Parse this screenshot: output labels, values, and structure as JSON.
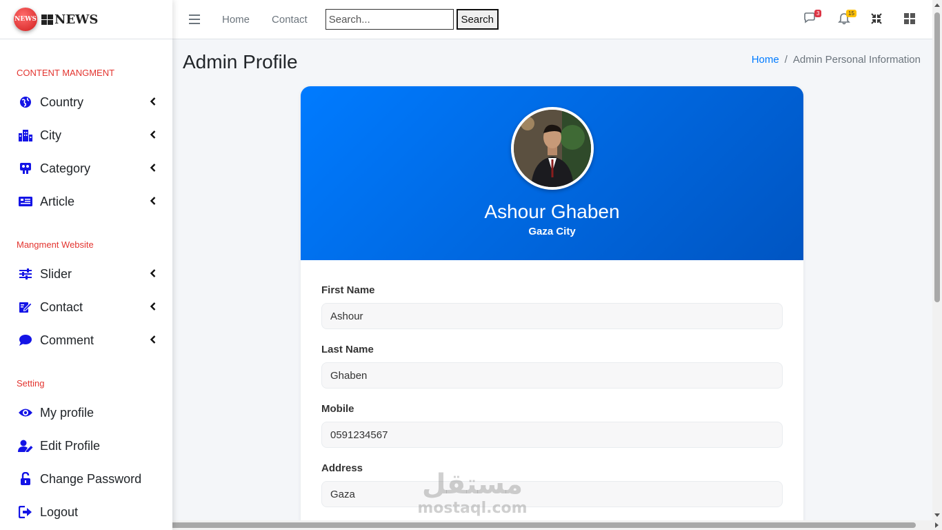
{
  "brand": {
    "logo_text": "NEWS",
    "name": "NEWS"
  },
  "sidebar": {
    "sections": [
      {
        "header": "CONTENT MANGMENT"
      },
      {
        "header": "Mangment Website"
      },
      {
        "header": "Setting"
      }
    ],
    "items": [
      {
        "label": "Country",
        "icon": "globe-icon"
      },
      {
        "label": "City",
        "icon": "city-icon"
      },
      {
        "label": "Category",
        "icon": "category-icon"
      },
      {
        "label": "Article",
        "icon": "article-icon"
      },
      {
        "label": "Slider",
        "icon": "sliders-icon"
      },
      {
        "label": "Contact",
        "icon": "edit-icon"
      },
      {
        "label": "Comment",
        "icon": "comment-icon"
      },
      {
        "label": "My profile",
        "icon": "eye-icon"
      },
      {
        "label": "Edit Profile",
        "icon": "user-edit-icon"
      },
      {
        "label": "Change Password",
        "icon": "lock-open-icon"
      },
      {
        "label": "Logout",
        "icon": "logout-icon"
      }
    ]
  },
  "topbar": {
    "links": [
      "Home",
      "Contact"
    ],
    "search": {
      "placeholder": "Search...",
      "button": "Search"
    },
    "messages_badge": "3",
    "notifications_badge": "15"
  },
  "page": {
    "title": "Admin Profile",
    "breadcrumb": {
      "home": "Home",
      "separator": "/",
      "current": "Admin Personal Information"
    }
  },
  "profile": {
    "name": "Ashour Ghaben",
    "city": "Gaza City",
    "fields": [
      {
        "label": "First Name",
        "value": "Ashour"
      },
      {
        "label": "Last Name",
        "value": "Ghaben"
      },
      {
        "label": "Mobile",
        "value": "0591234567"
      },
      {
        "label": "Address",
        "value": "Gaza"
      }
    ]
  },
  "watermark": {
    "arabic": "مستقل",
    "latin": "mostaql.com"
  },
  "colors": {
    "primary": "#007bff",
    "sidebar_icon": "#1414e6",
    "section_header": "#e3342f",
    "badge_danger": "#dc3545",
    "badge_warning": "#ffc107"
  }
}
